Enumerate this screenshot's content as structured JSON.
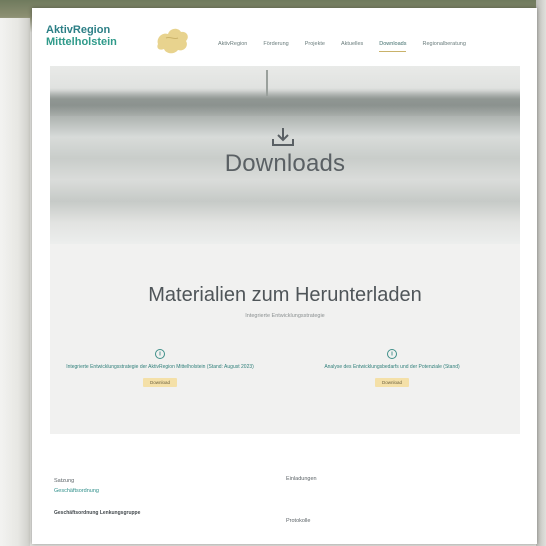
{
  "header": {
    "logo_line1": "AktivRegion",
    "logo_line2": "Mittelholstein",
    "nav": [
      "AktivRegion",
      "Förderung",
      "Projekte",
      "Aktuelles",
      "Downloads",
      "Regionalberatung"
    ],
    "active_nav": "Downloads"
  },
  "hero": {
    "title": "Downloads"
  },
  "materials": {
    "title": "Materialien zum Herunterladen",
    "subtitle": "Integrierte Entwicklungsstrategie",
    "items": [
      {
        "text": "Integrierte Entwicklungsstrategie der AktivRegion Mittelholstein (Stand: August 2023)",
        "button": "Download"
      },
      {
        "text": "Analyse des Entwicklungsbedarfs und der Potenziale (Stand)",
        "button": "Download"
      }
    ]
  },
  "footer": {
    "label_left": "Satzung",
    "link_left": "Geschäftsordnung",
    "bold_left": "Geschäftsordnung Lenkungsgruppe",
    "label_right_top": "Einladungen",
    "label_right_bottom": "Protokolle"
  },
  "colors": {
    "brand_teal": "#2f8f8a",
    "button_yellow": "#f4e0a8",
    "nav_underline": "#c9b26a"
  }
}
